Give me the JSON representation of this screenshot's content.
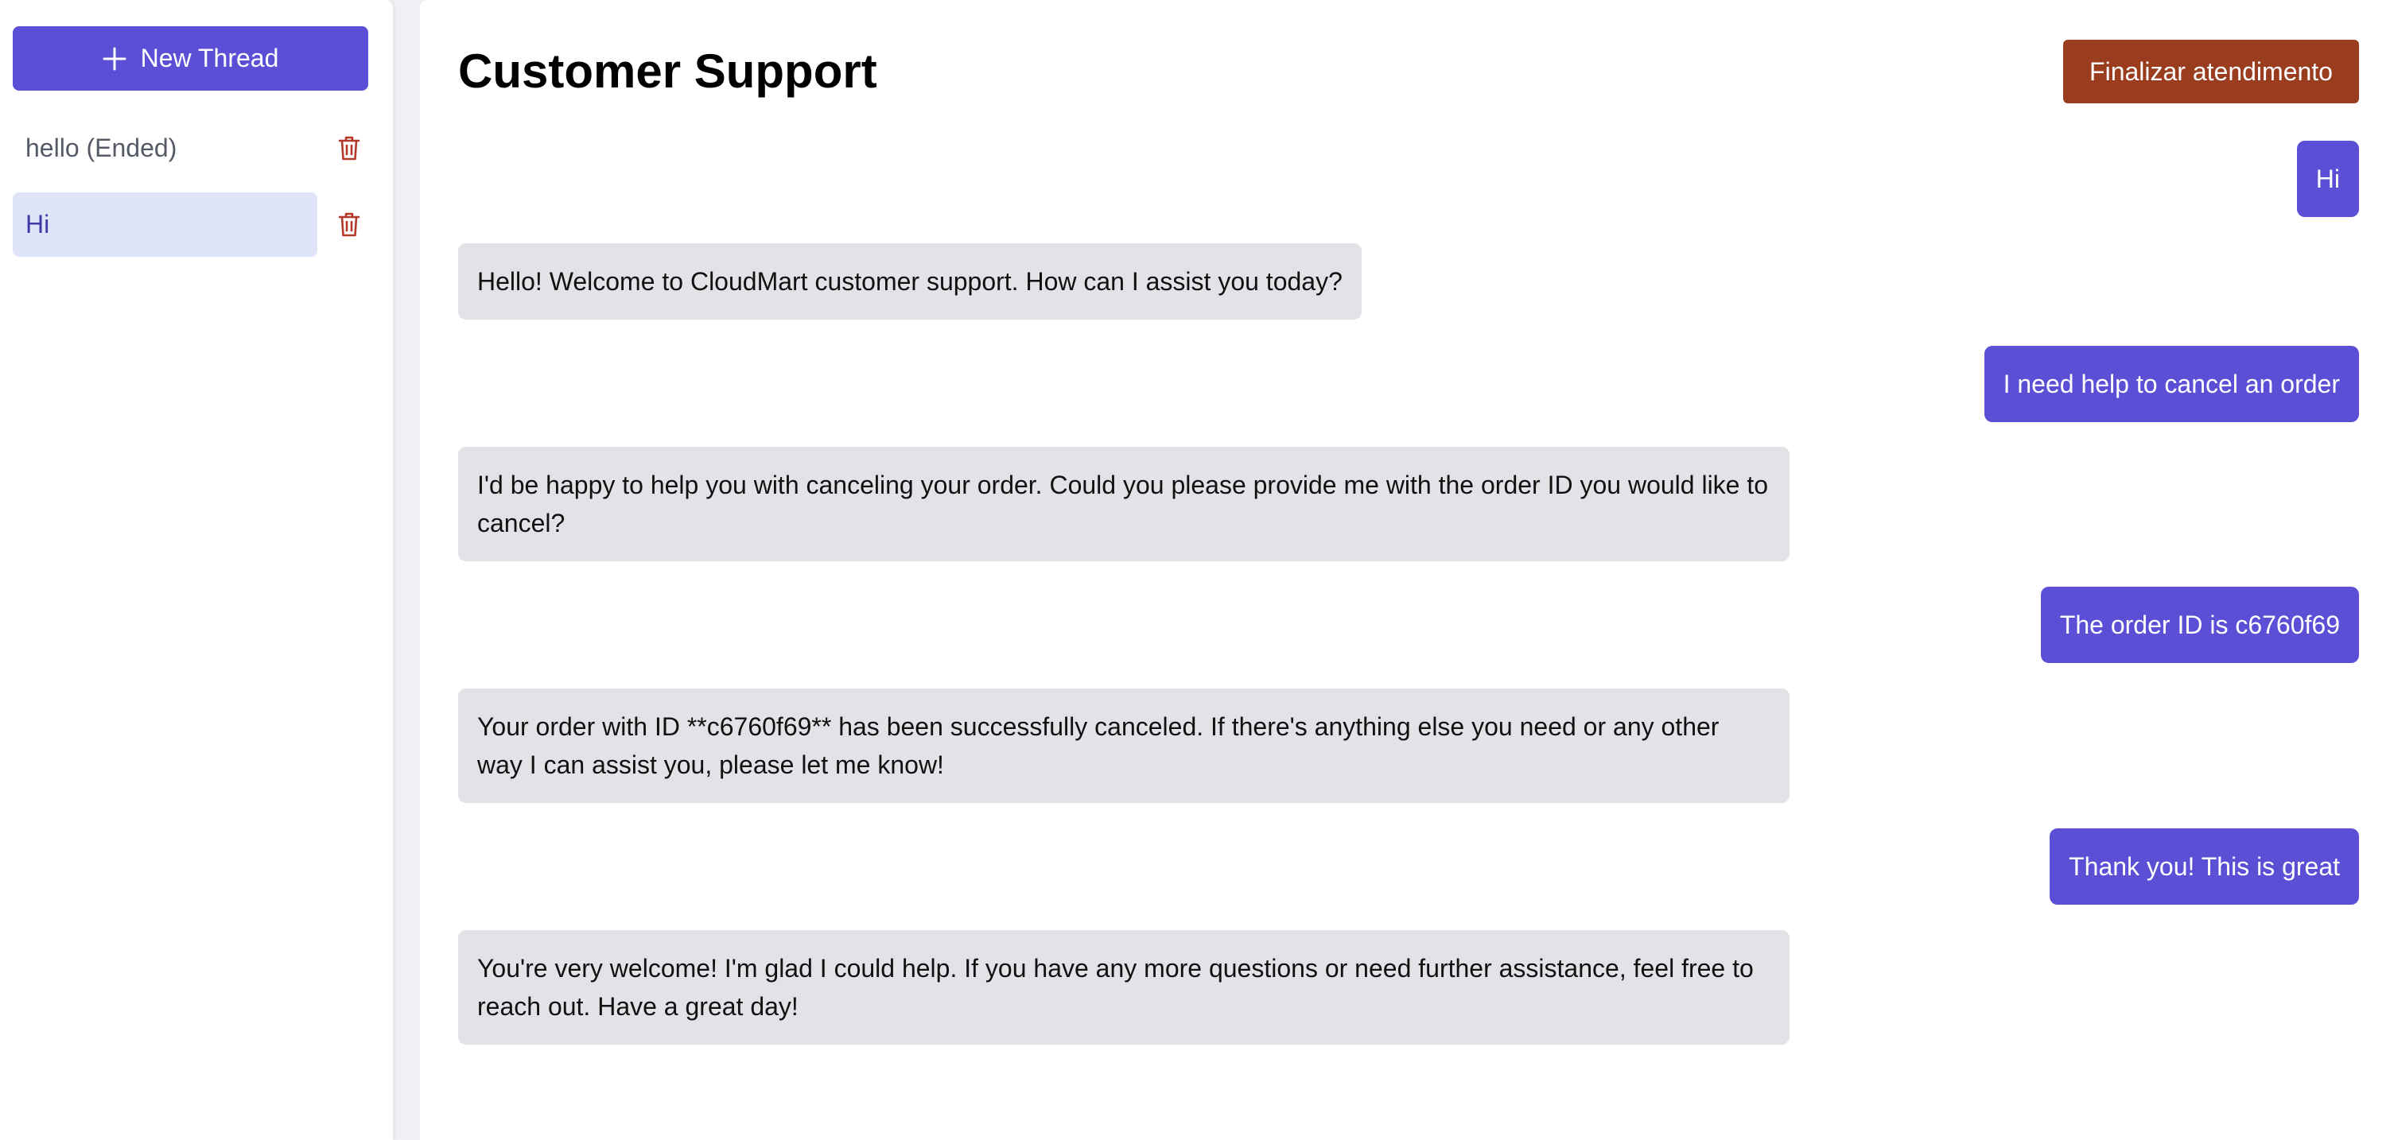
{
  "colors": {
    "accent": "#5b4fd6",
    "danger": "#9a3d1f",
    "active_thread_bg": "#e0e4f8",
    "bot_bubble_bg": "#e2e3e7",
    "trash_icon": "#b33a2a"
  },
  "sidebar": {
    "new_thread_label": "New Thread",
    "new_thread_icon": "plus-icon",
    "threads": [
      {
        "label": "hello (Ended)",
        "state": "ended",
        "delete_icon": "trash-icon"
      },
      {
        "label": "Hi",
        "state": "active",
        "delete_icon": "trash-icon"
      }
    ]
  },
  "main": {
    "title": "Customer Support",
    "end_button_label": "Finalizar atendimento",
    "messages": [
      {
        "role": "user",
        "text": "Hi"
      },
      {
        "role": "assistant",
        "text": "Hello! Welcome to CloudMart customer support. How can I assist you today?"
      },
      {
        "role": "user",
        "text": "I need help to cancel an order"
      },
      {
        "role": "assistant",
        "text": "I'd be happy to help you with canceling your order. Could you please provide me with the order ID you would like to cancel?"
      },
      {
        "role": "user",
        "text": "The order ID is c6760f69"
      },
      {
        "role": "assistant",
        "text": "Your order with ID **c6760f69** has been successfully canceled. If there's anything else you need or any other way I can assist you, please let me know!"
      },
      {
        "role": "user",
        "text": "Thank you! This is great"
      },
      {
        "role": "assistant",
        "text": "You're very welcome! I'm glad I could help. If you have any more questions or need further assistance, feel free to reach out. Have a great day!"
      }
    ]
  }
}
